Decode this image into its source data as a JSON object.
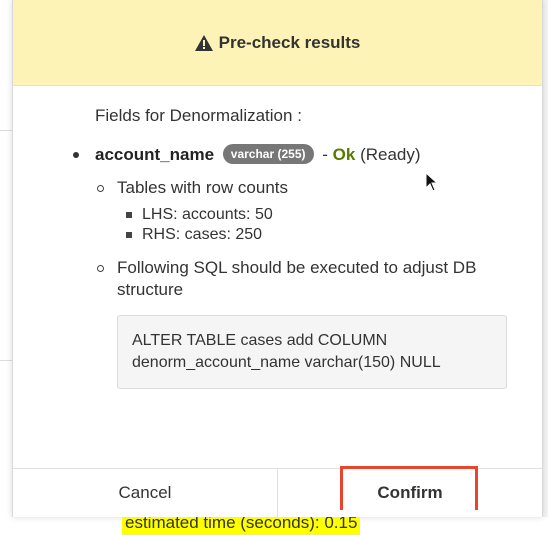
{
  "modal": {
    "title": "Pre-check results",
    "intro": "Fields for Denormalization :",
    "field": {
      "name": "account_name",
      "type_badge": "varchar (255)",
      "separator": "-",
      "status": "Ok",
      "status_note": "(Ready)"
    },
    "details": {
      "tables_heading": "Tables with row counts",
      "tables": [
        "LHS: accounts: 50",
        "RHS: cases: 250"
      ],
      "sql_heading": "Following SQL should be executed to adjust DB structure",
      "sql_line1": "ALTER TABLE cases add COLUMN",
      "sql_line2": "denorm_account_name varchar(150) NULL"
    },
    "estimate": "estimated time (seconds): 0.15",
    "buttons": {
      "cancel": "Cancel",
      "confirm": "Confirm"
    }
  },
  "colors": {
    "header_bg": "#fdf3b6",
    "ok_text": "#5a7a00",
    "highlight": "#ffff00",
    "confirm_outline": "#e8452c"
  },
  "icons": {
    "header": "warning-icon",
    "pointer": "mouse-cursor-icon"
  }
}
